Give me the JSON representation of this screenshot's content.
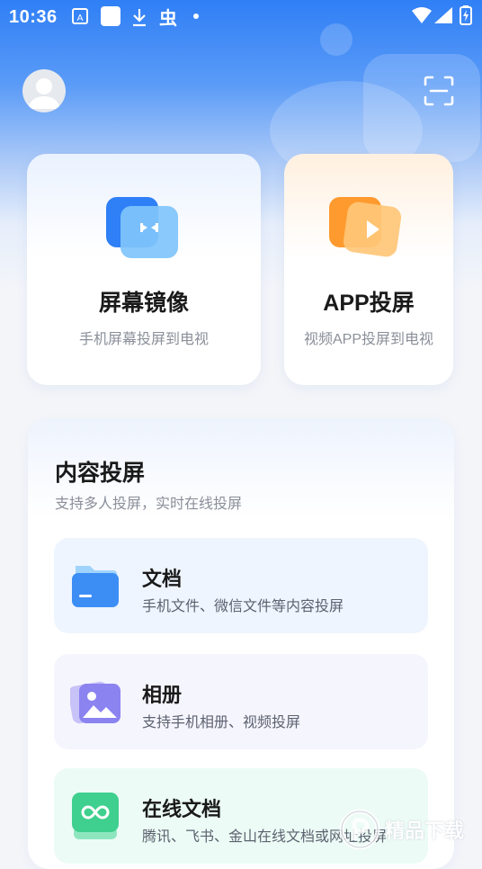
{
  "status_bar": {
    "time": "10:36"
  },
  "mirror_card": {
    "title": "屏幕镜像",
    "subtitle": "手机屏幕投屏到电视"
  },
  "app_card": {
    "title": "APP投屏",
    "subtitle": "视频APP投屏到电视"
  },
  "content_section": {
    "title": "内容投屏",
    "subtitle": "支持多人投屏，实时在线投屏",
    "items": [
      {
        "title": "文档",
        "desc": "手机文件、微信文件等内容投屏",
        "icon": "folder-icon"
      },
      {
        "title": "相册",
        "desc": "支持手机相册、视频投屏",
        "icon": "photo-album-icon"
      },
      {
        "title": "在线文档",
        "desc": "腾讯、飞书、金山在线文档或网址投屏",
        "icon": "link-icon"
      }
    ]
  },
  "watermark": {
    "text": "精品下载"
  },
  "colors": {
    "primary_blue": "#2f7ff6",
    "orange": "#ff9a2e",
    "green": "#3fcf8e",
    "purple": "#8b83f0"
  }
}
